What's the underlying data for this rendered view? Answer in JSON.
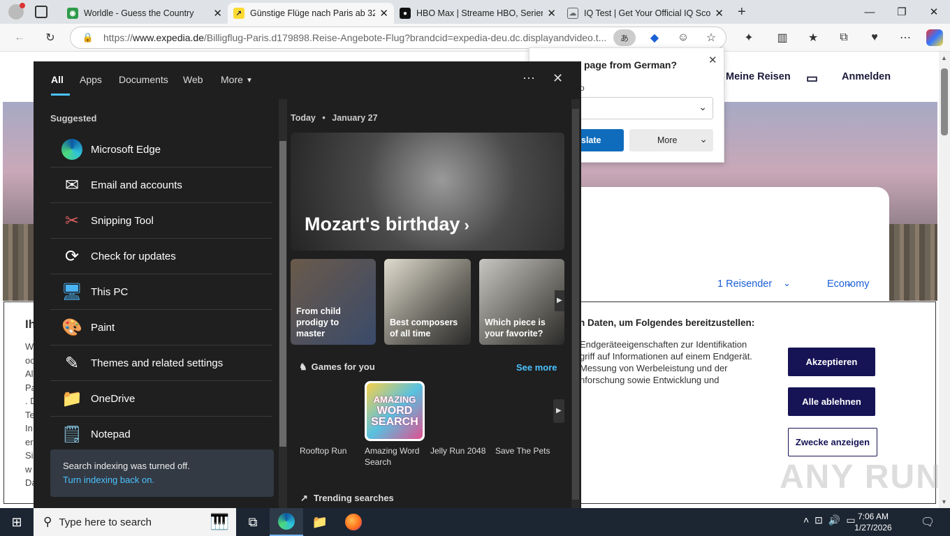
{
  "browser": {
    "tabs": [
      {
        "title": "Worldle - Guess the Country"
      },
      {
        "title": "Günstige Flüge nach Paris ab 32 €"
      },
      {
        "title": "HBO Max | Streame HBO, Serien, F"
      },
      {
        "title": "IQ Test | Get Your Official IQ Score"
      }
    ],
    "url_prefix": "https://",
    "url_domain": "www.expedia.de",
    "url_rest": "/Billigflug-Paris.d179898.Reise-Angebote-Flug?brandcid=expedia-deu.dc.displayandvideo.t..."
  },
  "translate": {
    "title": "page from German?",
    "label": "o",
    "translate_btn": "slate",
    "more_btn": "More"
  },
  "page": {
    "nav_trips": "Meine Reisen",
    "nav_signin": "Anmelden",
    "travelers": "1 Reisender",
    "cabin": "Economy",
    "consent_title_left": "Ih",
    "consent_heading": "n Daten, um Folgendes bereitzustellen:",
    "consent_lines": [
      "Endgeräteeigenschaften zur Identifikation",
      "griff auf Informationen auf einem Endgerät.",
      "Messung von Werbeleistung und der",
      "nforschung sowie Entwicklung und"
    ],
    "left_frag": [
      "W",
      "oc",
      "Al",
      "Pa",
      ". D",
      "Te",
      "In",
      "er",
      "Si",
      "w",
      "Da"
    ],
    "btn_accept": "Akzeptieren",
    "btn_reject": "Alle ablehnen",
    "btn_purposes": "Zwecke anzeigen",
    "watermark": "ANY RUN"
  },
  "start": {
    "tabs": [
      "All",
      "Apps",
      "Documents",
      "Web",
      "More"
    ],
    "suggested_label": "Suggested",
    "suggested": [
      {
        "label": "Microsoft Edge",
        "icon": "edge-icon"
      },
      {
        "label": "Email and accounts",
        "icon": "mail-icon"
      },
      {
        "label": "Snipping Tool",
        "icon": "snipping-tool-icon"
      },
      {
        "label": "Check for updates",
        "icon": "sync-icon"
      },
      {
        "label": "This PC",
        "icon": "pc-icon"
      },
      {
        "label": "Paint",
        "icon": "paint-icon"
      },
      {
        "label": "Themes and related settings",
        "icon": "themes-icon"
      },
      {
        "label": "OneDrive",
        "icon": "onedrive-icon"
      },
      {
        "label": "Notepad",
        "icon": "notepad-icon"
      }
    ],
    "indexing_msg": "Search indexing was turned off.",
    "indexing_link": "Turn indexing back on.",
    "today_label": "Today",
    "today_date": "January 27",
    "hero_title": "Mozart's birthday",
    "tiles": [
      {
        "caption": "From child prodigy to master"
      },
      {
        "caption": "Best composers of all time"
      },
      {
        "caption": "Which piece is your favorite?"
      }
    ],
    "games_label": "Games for you",
    "see_more": "See more",
    "games": [
      "Rooftop Run",
      "Amazing Word Search",
      "Jelly Run 2048",
      "Save The Pets"
    ],
    "game_logo": [
      "AMAZING",
      "WORD",
      "SEARCH"
    ],
    "trending_label": "Trending searches"
  },
  "taskbar": {
    "search_placeholder": "Type here to search",
    "time": "7:06 AM",
    "date": "1/27/2026"
  }
}
